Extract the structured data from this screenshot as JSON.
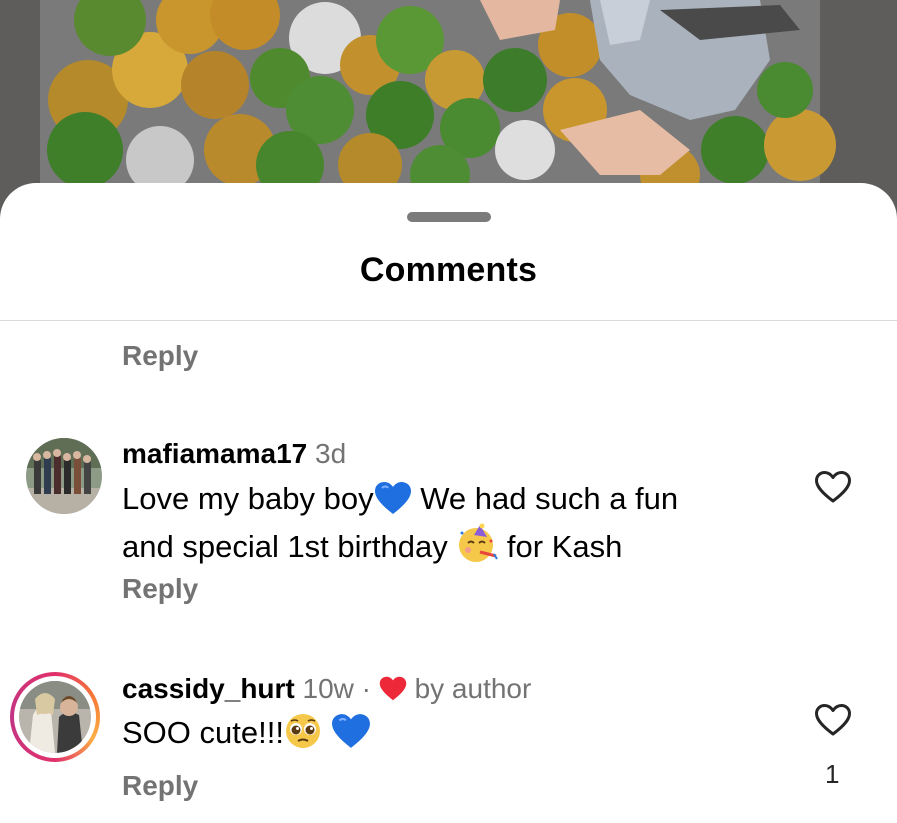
{
  "sheet": {
    "title": "Comments"
  },
  "comments": [
    {
      "reply_label": "Reply"
    },
    {
      "username": "mafiamama17",
      "time": "3d",
      "text_part1": "Love my baby boy",
      "text_part2": " We had such a fun",
      "text_part3": "and special 1st birthday ",
      "text_part4": " for Kash",
      "reply_label": "Reply",
      "icons": [
        "blue-heart-emoji",
        "partying-face-emoji",
        "like-heart-icon"
      ]
    },
    {
      "username": "cassidy_hurt",
      "time": "10w",
      "separator": " · ",
      "author_label": "by author",
      "text_part1": "SOO cute!!!",
      "like_count": "1",
      "reply_label": "Reply",
      "icons": [
        "red-heart-icon",
        "pleading-face-emoji",
        "blue-heart-emoji",
        "like-heart-icon"
      ]
    }
  ],
  "colors": {
    "blue_heart": "#1f6fe0",
    "red_heart": "#ed2939",
    "gray_text": "#737373"
  }
}
